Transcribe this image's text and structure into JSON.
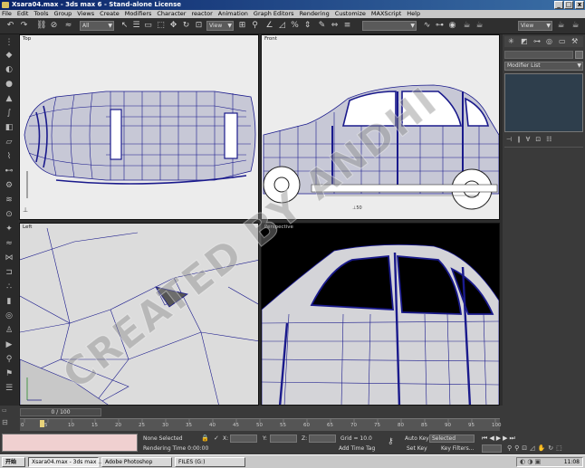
{
  "window": {
    "title": "Xsara04.max - 3ds max 6 - Stand-alone License",
    "min": "_",
    "max": "□",
    "close": "x"
  },
  "menu": [
    "File",
    "Edit",
    "Tools",
    "Group",
    "Views",
    "Create",
    "Modifiers",
    "Character",
    "reactor",
    "Animation",
    "Graph Editors",
    "Rendering",
    "Customize",
    "MAXScript",
    "Help"
  ],
  "toolbar": {
    "selection_filter": "All",
    "ref_coord": "View",
    "named_selection": "",
    "right_view": "View"
  },
  "viewports": {
    "top": "Top",
    "front": "Front",
    "left": "Left",
    "perspective": "Perspective"
  },
  "watermark": "CREATED BY ANDHI",
  "command_panel": {
    "modifier_list": "Modifier List"
  },
  "timeline": {
    "frame": "0 / 100",
    "ticks": [
      "0",
      "5",
      "10",
      "15",
      "20",
      "25",
      "30",
      "35",
      "40",
      "45",
      "50",
      "55",
      "60",
      "65",
      "70",
      "75",
      "80",
      "85",
      "90",
      "95",
      "100"
    ]
  },
  "status": {
    "selection": "None Selected",
    "render_time": "Rendering Time  0:00:00",
    "x_label": "X:",
    "y_label": "Y:",
    "z_label": "Z:",
    "grid": "Grid = 10.0",
    "add_time_tag": "Add Time Tag",
    "auto_key": "Auto Key",
    "auto_key_mode": "Selected",
    "set_key": "Set Key",
    "key_filters": "Key Filters..."
  },
  "taskbar": {
    "start": "开始",
    "tasks": [
      "Xsara04.max - 3ds max ...",
      "Adobe Photoshop",
      "FILES (G:)"
    ],
    "clock": "11:08"
  },
  "colors": {
    "viewport_bg": "#ececec",
    "wire": "#1a1a8c",
    "perspective_bg": "#000000",
    "title_gradient_start": "#0a246a"
  }
}
